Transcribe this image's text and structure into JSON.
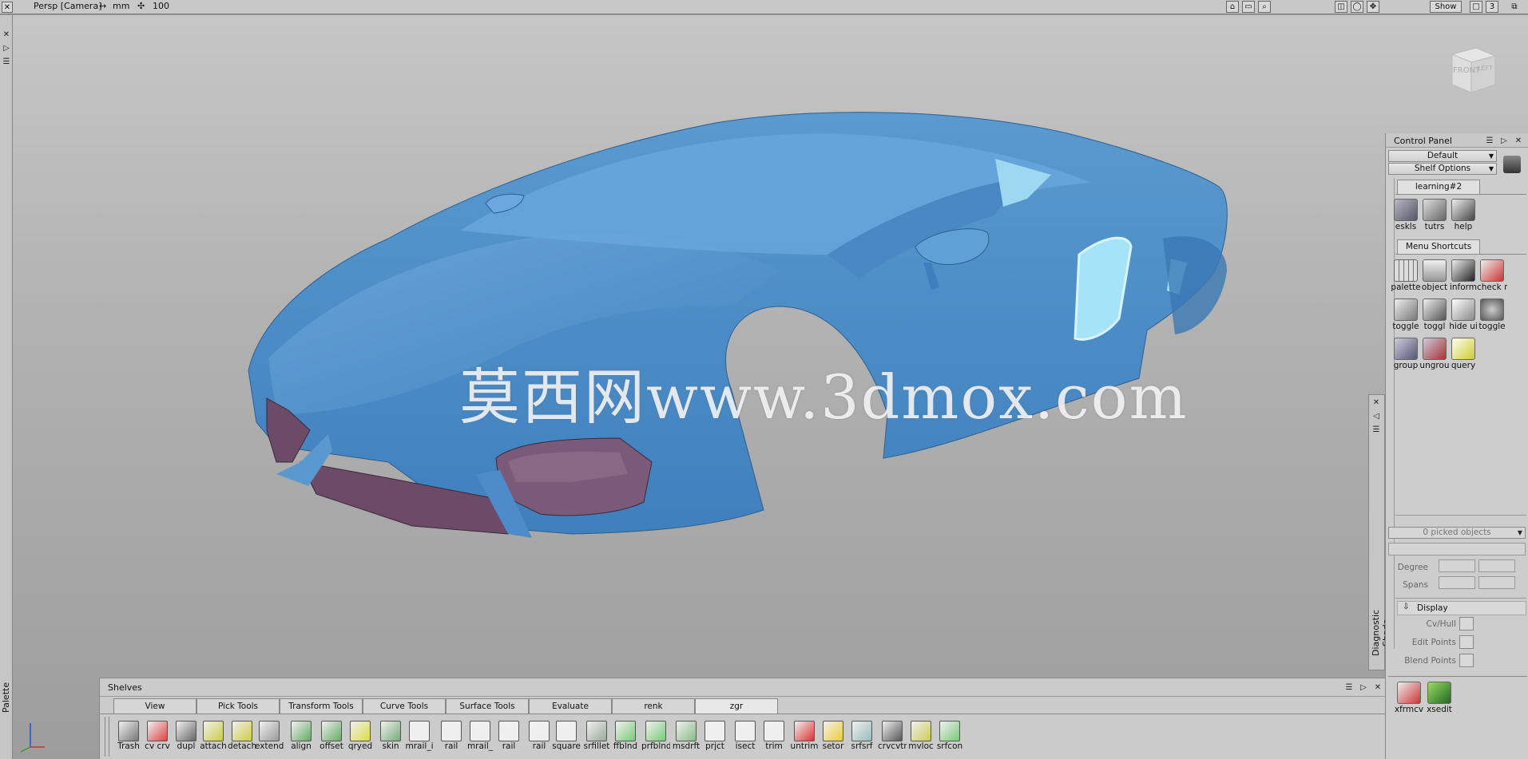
{
  "viewport": {
    "camera": "Persp [Camera]",
    "units": "mm",
    "zoom": "100",
    "show_button": "Show",
    "layout_number": "3",
    "cube_front": "FRONT",
    "cube_left": "LEFT",
    "watermark": "莫西网www.3dmox.com"
  },
  "control_panel": {
    "title": "Control Panel",
    "default_dropdown": "Default",
    "shelf_options": "Shelf Options",
    "tab_learning": "learning#2",
    "learning_tools": [
      {
        "label": "eskls",
        "icon": "satellite-icon"
      },
      {
        "label": "tutrs",
        "icon": "tutorial-icon"
      },
      {
        "label": "help",
        "icon": "help-book-icon"
      }
    ],
    "tab_menu_shortcuts": "Menu Shortcuts",
    "shortcut_tools": [
      {
        "label": "palette",
        "icon": "palette-icon"
      },
      {
        "label": "object",
        "icon": "object-icon"
      },
      {
        "label": "inform",
        "icon": "info-icon"
      },
      {
        "label": "check r",
        "icon": "check-icon"
      },
      {
        "label": "toggle",
        "icon": "toggle-icon"
      },
      {
        "label": "toggl",
        "icon": "toggle-icon"
      },
      {
        "label": "hide ui",
        "icon": "hide-icon"
      },
      {
        "label": "toggle",
        "icon": "toggle-icon"
      },
      {
        "label": "group",
        "icon": "group-icon"
      },
      {
        "label": "ungrou",
        "icon": "ungroup-icon"
      },
      {
        "label": "query",
        "icon": "query-icon"
      }
    ],
    "picked_objects": "0 picked objects",
    "degree_label": "Degree",
    "spans_label": "Spans",
    "display_label": "Display",
    "cv_hull": "Cv/Hull",
    "edit_points": "Edit Points",
    "blend_points": "Blend Points",
    "bottom_tools": [
      {
        "label": "xfrmcv",
        "icon": "xfrmcv-icon"
      },
      {
        "label": "xsedit",
        "icon": "xsedit-icon"
      }
    ]
  },
  "diagnostic_label": "Diagnostic Shade",
  "palette_label": "Palette",
  "shelves": {
    "title": "Shelves",
    "tabs": [
      "View",
      "Pick Tools",
      "Transform Tools",
      "Curve Tools",
      "Surface Tools",
      "Evaluate",
      "renk",
      "zgr"
    ],
    "active_tab": "zgr",
    "tools": [
      "Trash",
      "cv crv",
      "dupl",
      "attach",
      "detach",
      "extend",
      "align",
      "offset",
      "qryed",
      "skin",
      "mrail_i",
      "rail",
      "mrail_",
      "rail",
      "rail",
      "square",
      "srfillet",
      "ffblnd",
      "prfblnd",
      "msdrft",
      "prjct",
      "isect",
      "trim",
      "untrim",
      "setor",
      "srfsrf",
      "crvcvtr",
      "mvloc",
      "srfcon"
    ]
  },
  "colors": {
    "car_body": "#4f8fc8",
    "car_trim": "#6c4a68",
    "viewport_bg": "#b0b0b0",
    "panel_bg": "#cdcdcd"
  }
}
